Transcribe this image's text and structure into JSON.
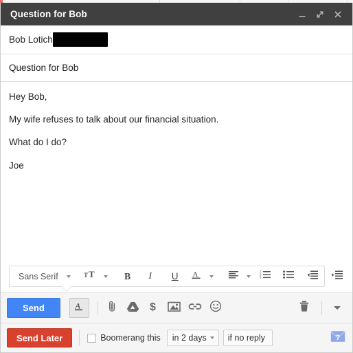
{
  "window": {
    "title": "Question for Bob",
    "controls": {
      "minimize": "minimize-icon",
      "fullscreen": "fullscreen-icon",
      "close": "close-icon"
    }
  },
  "fields": {
    "to_label": "Bob Lotich",
    "to_redacted": true,
    "subject": "Question for Bob"
  },
  "body": {
    "paragraphs": [
      "Hey Bob,",
      "My wife refuses to talk about our financial situation.",
      "What do I do?",
      "Joe"
    ]
  },
  "format_toolbar": {
    "font_name": "Sans Serif",
    "items": [
      {
        "name": "font-family-dropdown",
        "label": "Sans Serif",
        "icon": "chevron-down-icon"
      },
      {
        "name": "font-size-button",
        "label": "",
        "icon": "text-size-icon"
      },
      {
        "name": "bold-button",
        "label": "B",
        "icon": "bold-icon"
      },
      {
        "name": "italic-button",
        "label": "I",
        "icon": "italic-icon"
      },
      {
        "name": "underline-button",
        "label": "U",
        "icon": "underline-icon"
      },
      {
        "name": "text-color-button",
        "label": "A",
        "icon": "text-color-icon"
      },
      {
        "name": "align-button",
        "label": "",
        "icon": "align-left-icon"
      },
      {
        "name": "numbered-list-button",
        "label": "",
        "icon": "numbered-list-icon"
      },
      {
        "name": "bulleted-list-button",
        "label": "",
        "icon": "bulleted-list-icon"
      },
      {
        "name": "indent-less-button",
        "label": "",
        "icon": "indent-less-icon"
      },
      {
        "name": "indent-more-button",
        "label": "",
        "icon": "indent-more-icon"
      },
      {
        "name": "quote-button",
        "label": "",
        "icon": "quote-icon"
      },
      {
        "name": "remove-formatting-button",
        "label": "",
        "icon": "remove-formatting-icon"
      }
    ]
  },
  "send_row": {
    "send_label": "Send",
    "formatting_toggle_label": "A",
    "icons": [
      {
        "name": "attach-file-icon",
        "title": "Attach files"
      },
      {
        "name": "google-drive-icon",
        "title": "Insert files using Drive"
      },
      {
        "name": "insert-money-icon",
        "title": "Insert money"
      },
      {
        "name": "insert-photo-icon",
        "title": "Insert photo"
      },
      {
        "name": "insert-link-icon",
        "title": "Insert link"
      },
      {
        "name": "insert-emoji-icon",
        "title": "Insert emoticon"
      }
    ],
    "trash_icon": "discard-draft-icon",
    "more_options_icon": "more-options-icon"
  },
  "boomerang_row": {
    "send_later_label": "Send Later",
    "checkbox_label": "Boomerang this",
    "checkbox_checked": false,
    "delay_value": "in 2 days",
    "condition_value": "if no reply",
    "help_icon": "boomerang-help-icon"
  },
  "colors": {
    "titlebar": "#404040",
    "send_button": "#4285f4",
    "send_later_button": "#d9412e",
    "toolbar_background": "#f5f5f5",
    "help_icon": "#8ca8e8"
  }
}
